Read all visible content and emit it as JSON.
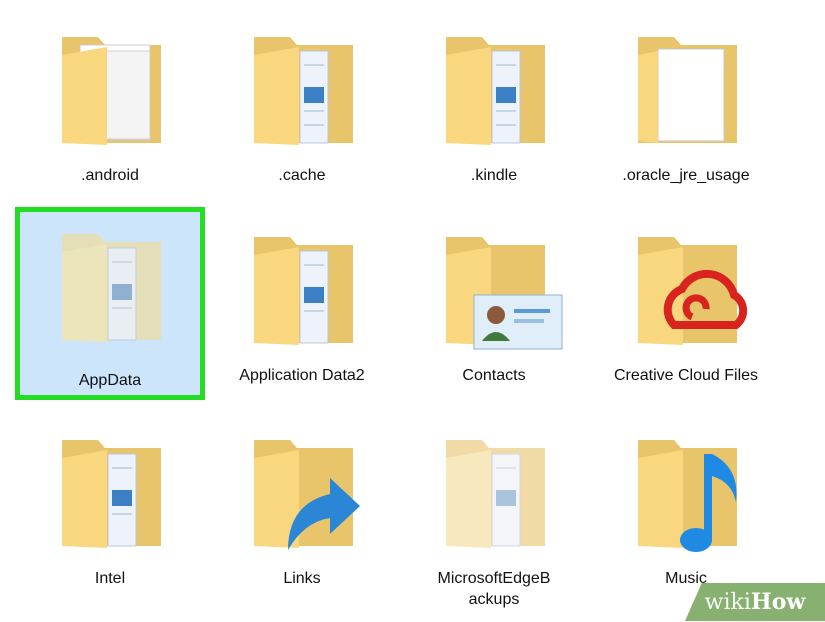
{
  "items": [
    {
      "name": ".android",
      "kind": "docs",
      "selected": false
    },
    {
      "name": ".cache",
      "kind": "strip",
      "selected": false
    },
    {
      "name": ".kindle",
      "kind": "strip",
      "selected": false
    },
    {
      "name": ".oracle_jre_usage",
      "kind": "doc",
      "selected": false
    },
    {
      "name": "AppData",
      "kind": "strip",
      "selected": true
    },
    {
      "name": "Application Data2",
      "kind": "strip",
      "selected": false
    },
    {
      "name": "Contacts",
      "kind": "contact",
      "selected": false
    },
    {
      "name": "Creative Cloud Files",
      "kind": "cc",
      "selected": false
    },
    {
      "name": "Intel",
      "kind": "strip",
      "selected": false
    },
    {
      "name": "Links",
      "kind": "link",
      "selected": false
    },
    {
      "name": "MicrosoftEdgeBackups",
      "kind": "strip",
      "selected": false
    },
    {
      "name": "Music",
      "kind": "music",
      "selected": false
    }
  ],
  "watermark": {
    "part1": "wiki",
    "part2": "How"
  },
  "colors": {
    "selection_fill": "#cce5fb",
    "highlight_border": "#22dd22",
    "folder": "#f9d77e"
  }
}
